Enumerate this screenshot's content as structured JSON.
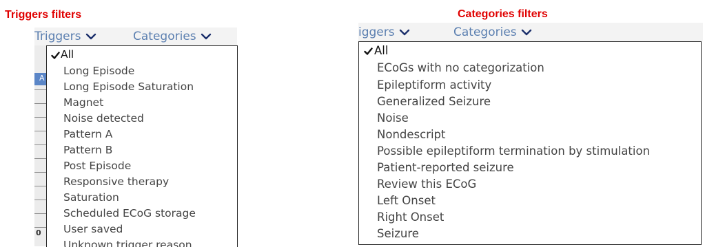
{
  "left": {
    "caption": "Triggers filters",
    "tabs": [
      "Triggers",
      "Categories"
    ],
    "options": [
      "All",
      "Long Episode",
      "Long Episode Saturation",
      "Magnet",
      "Noise detected",
      "Pattern A",
      "Pattern B",
      "Post Episode",
      "Responsive therapy",
      "Saturation",
      "Scheduled ECoG storage",
      "User saved",
      "Unknown trigger reason"
    ],
    "selected_index": 0,
    "header_letter": "A",
    "partial_cell": "0"
  },
  "right": {
    "caption": "Categories filters",
    "tabs": [
      "iggers",
      "Categories"
    ],
    "options": [
      "All",
      "ECoGs with no categorization",
      "Epileptiform activity",
      "Generalized Seizure",
      "Noise",
      "Nondescript",
      "Possible epileptiform termination by stimulation",
      "Patient-reported seizure",
      "Review this ECoG",
      "Left Onset",
      "Right Onset",
      "Seizure"
    ],
    "selected_index": 0
  },
  "colors": {
    "caption": "#e00000",
    "tab_text": "#5b7fb0",
    "chevron": "#1b2f6b",
    "grid_header": "#5b86c7"
  },
  "icons": {
    "check": "check-icon",
    "chevron": "chevron-down-icon"
  }
}
